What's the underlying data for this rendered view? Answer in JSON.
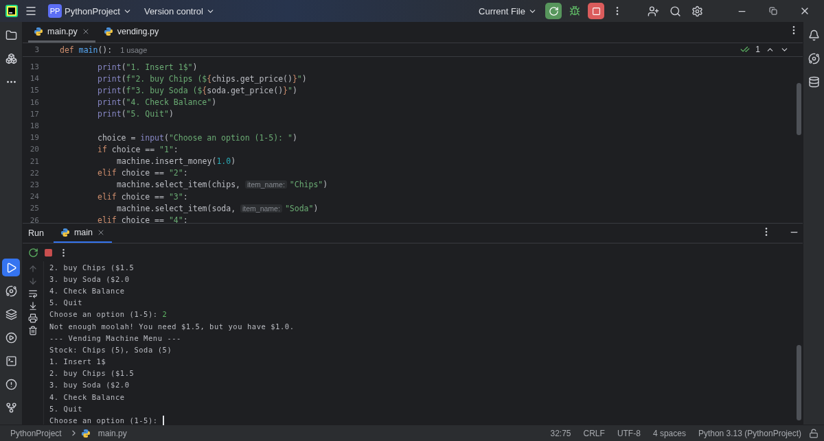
{
  "title_bar": {
    "project_badge": "PP",
    "project": "PythonProject",
    "vcs": "Version control",
    "run_config": "Current File"
  },
  "left_toolbar": {
    "top": [
      {
        "selected": false
      },
      {
        "selected": false
      },
      {
        "selected": false
      }
    ],
    "bottom": [
      {
        "selected": true
      },
      {
        "selected": false
      },
      {
        "selected": false
      },
      {
        "selected": false
      },
      {
        "selected": false
      },
      {
        "selected": false
      },
      {
        "selected": false
      }
    ]
  },
  "editor_tabs": [
    {
      "label": "main.py",
      "selected": true
    },
    {
      "label": "vending.py",
      "selected": false
    }
  ],
  "sticky_header": {
    "number": "3",
    "tokens": [
      {
        "kind": "kw",
        "text": "def "
      },
      {
        "kind": "fn",
        "text": "main"
      },
      {
        "kind": "plain",
        "text": "():"
      }
    ],
    "usages": "1 usage"
  },
  "inspection": {
    "count": "1"
  },
  "code_lines": [
    {
      "number": "13",
      "kind": "body",
      "tokens": [
        {
          "kind": "builtin",
          "text": "print"
        },
        {
          "kind": "plain",
          "text": "("
        },
        {
          "kind": "str",
          "text": "\"1. Insert 1$\""
        },
        {
          "kind": "plain",
          "text": ")"
        }
      ]
    },
    {
      "number": "14",
      "kind": "body",
      "tokens": [
        {
          "kind": "builtin",
          "text": "print"
        },
        {
          "kind": "plain",
          "text": "("
        },
        {
          "kind": "str",
          "text": "f\"2. buy Chips ($"
        },
        {
          "kind": "kw",
          "text": "{"
        },
        {
          "kind": "plain",
          "text": "chips.get_price()"
        },
        {
          "kind": "kw",
          "text": "}"
        },
        {
          "kind": "str",
          "text": "\""
        },
        {
          "kind": "plain",
          "text": ")"
        }
      ]
    },
    {
      "number": "15",
      "kind": "body",
      "tokens": [
        {
          "kind": "builtin",
          "text": "print"
        },
        {
          "kind": "plain",
          "text": "("
        },
        {
          "kind": "str",
          "text": "f\"3. buy Soda ($"
        },
        {
          "kind": "kw",
          "text": "{"
        },
        {
          "kind": "plain",
          "text": "soda.get_price()"
        },
        {
          "kind": "kw",
          "text": "}"
        },
        {
          "kind": "str",
          "text": "\""
        },
        {
          "kind": "plain",
          "text": ")"
        }
      ]
    },
    {
      "number": "16",
      "kind": "body",
      "tokens": [
        {
          "kind": "builtin",
          "text": "print"
        },
        {
          "kind": "plain",
          "text": "("
        },
        {
          "kind": "str",
          "text": "\"4. Check Balance\""
        },
        {
          "kind": "plain",
          "text": ")"
        }
      ]
    },
    {
      "number": "17",
      "kind": "body",
      "tokens": [
        {
          "kind": "builtin",
          "text": "print"
        },
        {
          "kind": "plain",
          "text": "("
        },
        {
          "kind": "str",
          "text": "\"5. Quit\""
        },
        {
          "kind": "plain",
          "text": ")"
        }
      ]
    },
    {
      "number": "18",
      "kind": "blank"
    },
    {
      "number": "19",
      "kind": "body",
      "tokens": [
        {
          "kind": "plain",
          "text": "choice = "
        },
        {
          "kind": "builtin",
          "text": "input"
        },
        {
          "kind": "plain",
          "text": "("
        },
        {
          "kind": "str",
          "text": "\"Choose an option (1-5): \""
        },
        {
          "kind": "plain",
          "text": ")"
        }
      ]
    },
    {
      "number": "20",
      "kind": "body",
      "tokens": [
        {
          "kind": "kw",
          "text": "if"
        },
        {
          "kind": "plain",
          "text": " choice == "
        },
        {
          "kind": "str",
          "text": "\"1\""
        },
        {
          "kind": "plain",
          "text": ":"
        }
      ]
    },
    {
      "number": "21",
      "kind": "nested",
      "tokens": [
        {
          "kind": "plain",
          "text": "machine.insert_money("
        },
        {
          "kind": "num",
          "text": "1.0"
        },
        {
          "kind": "plain",
          "text": ")"
        }
      ]
    },
    {
      "number": "22",
      "kind": "body",
      "tokens": [
        {
          "kind": "kw",
          "text": "elif"
        },
        {
          "kind": "plain",
          "text": " choice == "
        },
        {
          "kind": "str",
          "text": "\"2\""
        },
        {
          "kind": "plain",
          "text": ":"
        }
      ]
    },
    {
      "number": "23",
      "kind": "nested",
      "tokens": [
        {
          "kind": "plain",
          "text": "machine.select_item(chips, "
        },
        {
          "kind": "hint",
          "text": "item_name:"
        },
        {
          "kind": "str",
          "text": "\"Chips\""
        },
        {
          "kind": "plain",
          "text": ")"
        }
      ]
    },
    {
      "number": "24",
      "kind": "body",
      "tokens": [
        {
          "kind": "kw",
          "text": "elif"
        },
        {
          "kind": "plain",
          "text": " choice == "
        },
        {
          "kind": "str",
          "text": "\"3\""
        },
        {
          "kind": "plain",
          "text": ":"
        }
      ]
    },
    {
      "number": "25",
      "kind": "nested",
      "tokens": [
        {
          "kind": "plain",
          "text": "machine.select_item(soda, "
        },
        {
          "kind": "hint",
          "text": "item_name:"
        },
        {
          "kind": "str",
          "text": "\"Soda\""
        },
        {
          "kind": "plain",
          "text": ")"
        }
      ]
    },
    {
      "number": "26",
      "kind": "body",
      "tokens": [
        {
          "kind": "kw",
          "text": "elif"
        },
        {
          "kind": "plain",
          "text": " choice == "
        },
        {
          "kind": "str",
          "text": "\"4\""
        },
        {
          "kind": "plain",
          "text": ":"
        }
      ]
    }
  ],
  "run_panel": {
    "title": "Run",
    "tabs": [
      {
        "label": "main",
        "selected": true
      }
    ]
  },
  "console_lines": [
    {
      "text": "2. buy Chips ($1.5"
    },
    {
      "text": "3. buy Soda ($2.0"
    },
    {
      "text": "4. Check Balance"
    },
    {
      "text": "5. Quit"
    },
    {
      "text": "Choose an option (1-5): ",
      "input": "2"
    },
    {
      "text": "Not enough moolah! You need $1.5, but you have $1.0."
    },
    {
      "text": "--- Vending Machine Menu ---"
    },
    {
      "text": "Stock: Chips (5), Soda (5)"
    },
    {
      "text": "1. Insert 1$"
    },
    {
      "text": "2. buy Chips ($1.5"
    },
    {
      "text": "3. buy Soda ($2.0"
    },
    {
      "text": "4. Check Balance"
    },
    {
      "text": "5. Quit"
    },
    {
      "text": "Choose an option (1-5): ",
      "cursor": true
    }
  ],
  "status_bar": {
    "breadcrumbs": [
      "PythonProject",
      "main.py"
    ],
    "items": [
      "32:75",
      "CRLF",
      "UTF-8",
      "4 spaces",
      "Python 3.13 (PythonProject)"
    ]
  }
}
